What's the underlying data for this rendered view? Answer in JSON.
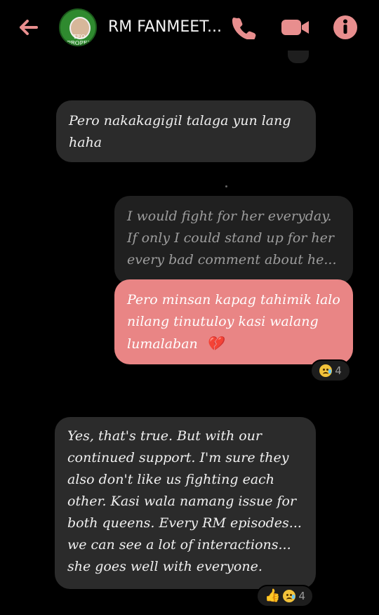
{
  "header": {
    "title": "RM FANMEET...",
    "avatar_text": "TEO PROPER",
    "accent": "#e88e8e"
  },
  "messages": [
    {
      "id": "m1",
      "side": "left",
      "text": "Pero nakakagigil talaga yun lang haha"
    },
    {
      "id": "m2",
      "side": "right",
      "style": "muted",
      "text": "I would fight for her everyday. If only I could stand up for her every bad comment about he..."
    },
    {
      "id": "m3",
      "side": "right",
      "style": "pink",
      "text": "Pero minsan kapag tahimik lalo nilang tinutuloy kasi walang lumalaban",
      "emoji": "💔"
    },
    {
      "id": "m4",
      "side": "left",
      "text": "Yes, that's true. But with our continued support. I'm sure they also don't like us fighting each other. Kasi wala namang issue for both queens. Every RM episodes... we can see a lot of interactions... she goes well with everyone."
    }
  ],
  "reactions": [
    {
      "icon": "sad-face-icon",
      "count": "4"
    },
    {
      "icon": "thumbs-up-sad-face-icons",
      "count": "4"
    }
  ],
  "colors": {
    "pink_bubble": "#e98585",
    "dark_bubble": "#2b2b2b",
    "muted_bubble": "#202020",
    "accent": "#e88e8e"
  }
}
